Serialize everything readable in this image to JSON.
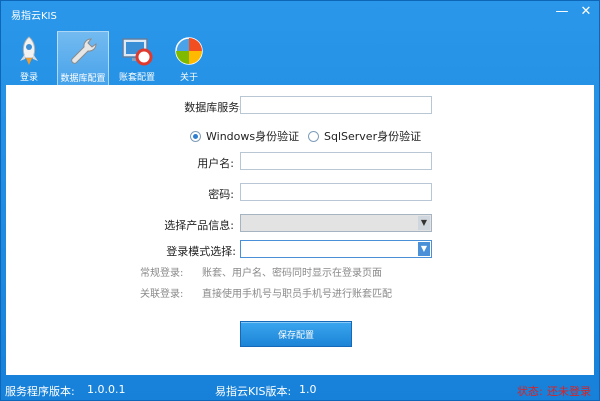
{
  "window": {
    "title": "易指云KIS"
  },
  "toolbar": {
    "items": [
      {
        "label": "登录",
        "icon": "rocket-icon"
      },
      {
        "label": "数据库配置",
        "icon": "wrench-icon",
        "active": true
      },
      {
        "label": "账套配置",
        "icon": "monitor-lifebuoy-icon"
      },
      {
        "label": "关于",
        "icon": "globe-icon"
      }
    ]
  },
  "form": {
    "server_label": "数据库服务器:",
    "server_value": "",
    "auth_windows": "Windows身份验证",
    "auth_sqlserver": "SqlServer身份验证",
    "auth_selected": "Windows身份验证",
    "user_label": "用户名:",
    "user_value": "",
    "password_label": "密码:",
    "password_value": "",
    "product_label": "选择产品信息:",
    "product_value": "",
    "login_mode_label": "登录模式选择:",
    "login_mode_value": "",
    "hint1_label": "常规登录:",
    "hint1_text": "账套、用户名、密码同时显示在登录页面",
    "hint2_label": "关联登录:",
    "hint2_text": "直接使用手机号与职员手机号进行账套匹配",
    "save_label": "保存配置"
  },
  "status": {
    "service_version_label": "服务程序版本:",
    "service_version": "1.0.0.1",
    "kis_version_label": "易指云KIS版本:",
    "kis_version": "1.0",
    "state_label": "状态:",
    "state_value": "还未登录"
  },
  "colors": {
    "accent": "#1a86dd",
    "status_red": "#e01f1f"
  }
}
